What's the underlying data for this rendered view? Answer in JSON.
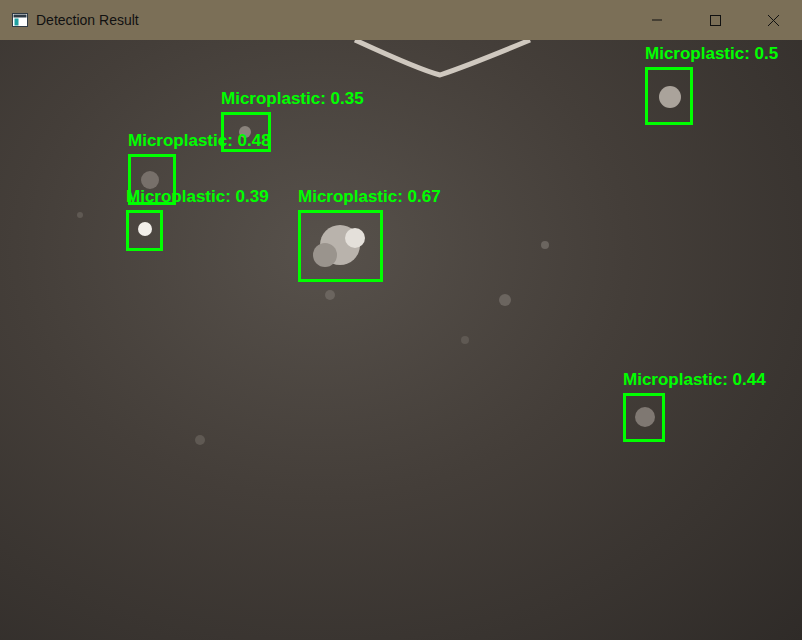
{
  "window": {
    "title": "Detection Result"
  },
  "detections": [
    {
      "label": "Microplastic: 0.35"
    },
    {
      "label": "Microplastic: 0.48"
    },
    {
      "label": "Microplastic: 0.39"
    },
    {
      "label": "Microplastic: 0.67"
    },
    {
      "label": "Microplastic: 0.5"
    },
    {
      "label": "Microplastic: 0.44"
    }
  ]
}
